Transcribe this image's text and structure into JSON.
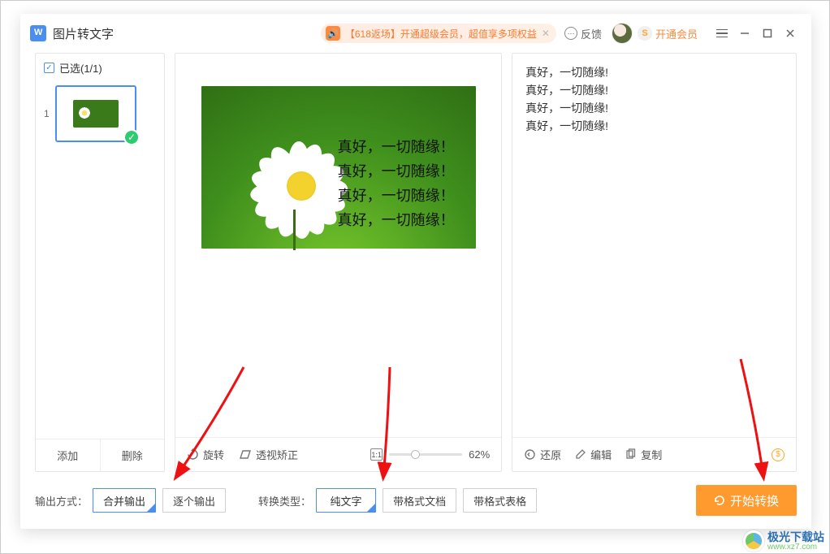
{
  "header": {
    "title": "图片转文字",
    "promo_text": "【618返场】开通超级会员，超值享多项权益",
    "feedback_label": "反馈",
    "vip_link": "开通会员"
  },
  "left_panel": {
    "selected_label": "已选(1/1)",
    "thumb_number": "1",
    "add_label": "添加",
    "delete_label": "删除"
  },
  "preview": {
    "text_lines": [
      "真好，一切随缘！",
      "真好，一切随缘！",
      "真好，一切随缘！",
      "真好，一切随缘！"
    ],
    "rotate_label": "旋转",
    "perspective_label": "透视矫正",
    "zoom_pct": "62%"
  },
  "result": {
    "lines": [
      "真好，一切随缘!",
      "真好，一切随缘!",
      "真好，一切随缘!",
      "真好，一切随缘!"
    ],
    "restore_label": "还原",
    "edit_label": "编辑",
    "copy_label": "复制"
  },
  "bottom": {
    "output_mode_label": "输出方式：",
    "output_merge": "合并输出",
    "output_each": "逐个输出",
    "convert_type_label": "转换类型：",
    "type_plain": "纯文字",
    "type_doc": "带格式文档",
    "type_table": "带格式表格",
    "start_label": "开始转换"
  },
  "watermark": {
    "name": "极光下载站",
    "url": "www.xz7.com"
  }
}
